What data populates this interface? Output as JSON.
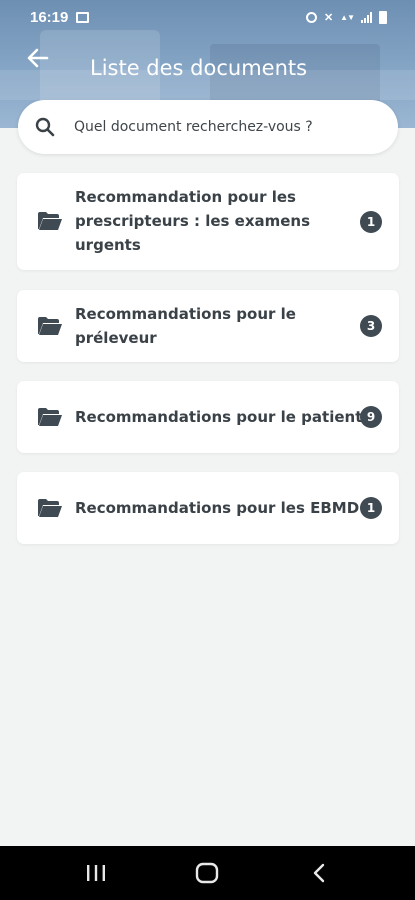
{
  "status_bar": {
    "time": "16:19",
    "icons": [
      "gallery-icon",
      "alarm-icon",
      "mute-icon",
      "wifi-signal-icon",
      "cell-signal-icon",
      "battery-icon"
    ]
  },
  "header": {
    "title": "Liste des documents",
    "back_icon": "arrow-left-icon"
  },
  "search": {
    "placeholder": "Quel document recherchez-vous ?",
    "icon": "search-icon"
  },
  "documents": [
    {
      "label": "Recommandation pour les prescripteurs : les examens urgents",
      "count": "1",
      "icon": "folder-open-icon"
    },
    {
      "label": "Recommandations pour le préleveur",
      "count": "3",
      "icon": "folder-open-icon"
    },
    {
      "label": "Recommandations pour le patient",
      "count": "9",
      "icon": "folder-open-icon"
    },
    {
      "label": "Recommandations pour les EBMD",
      "count": "1",
      "icon": "folder-open-icon"
    }
  ],
  "nav": {
    "buttons": [
      "recent-apps-icon",
      "home-icon",
      "back-icon"
    ]
  },
  "colors": {
    "header_gradient_top": "#6d8fb2",
    "background": "#f2f4f4",
    "text": "#3a4248",
    "badge": "#3f4a52",
    "navbar": "#000000"
  }
}
